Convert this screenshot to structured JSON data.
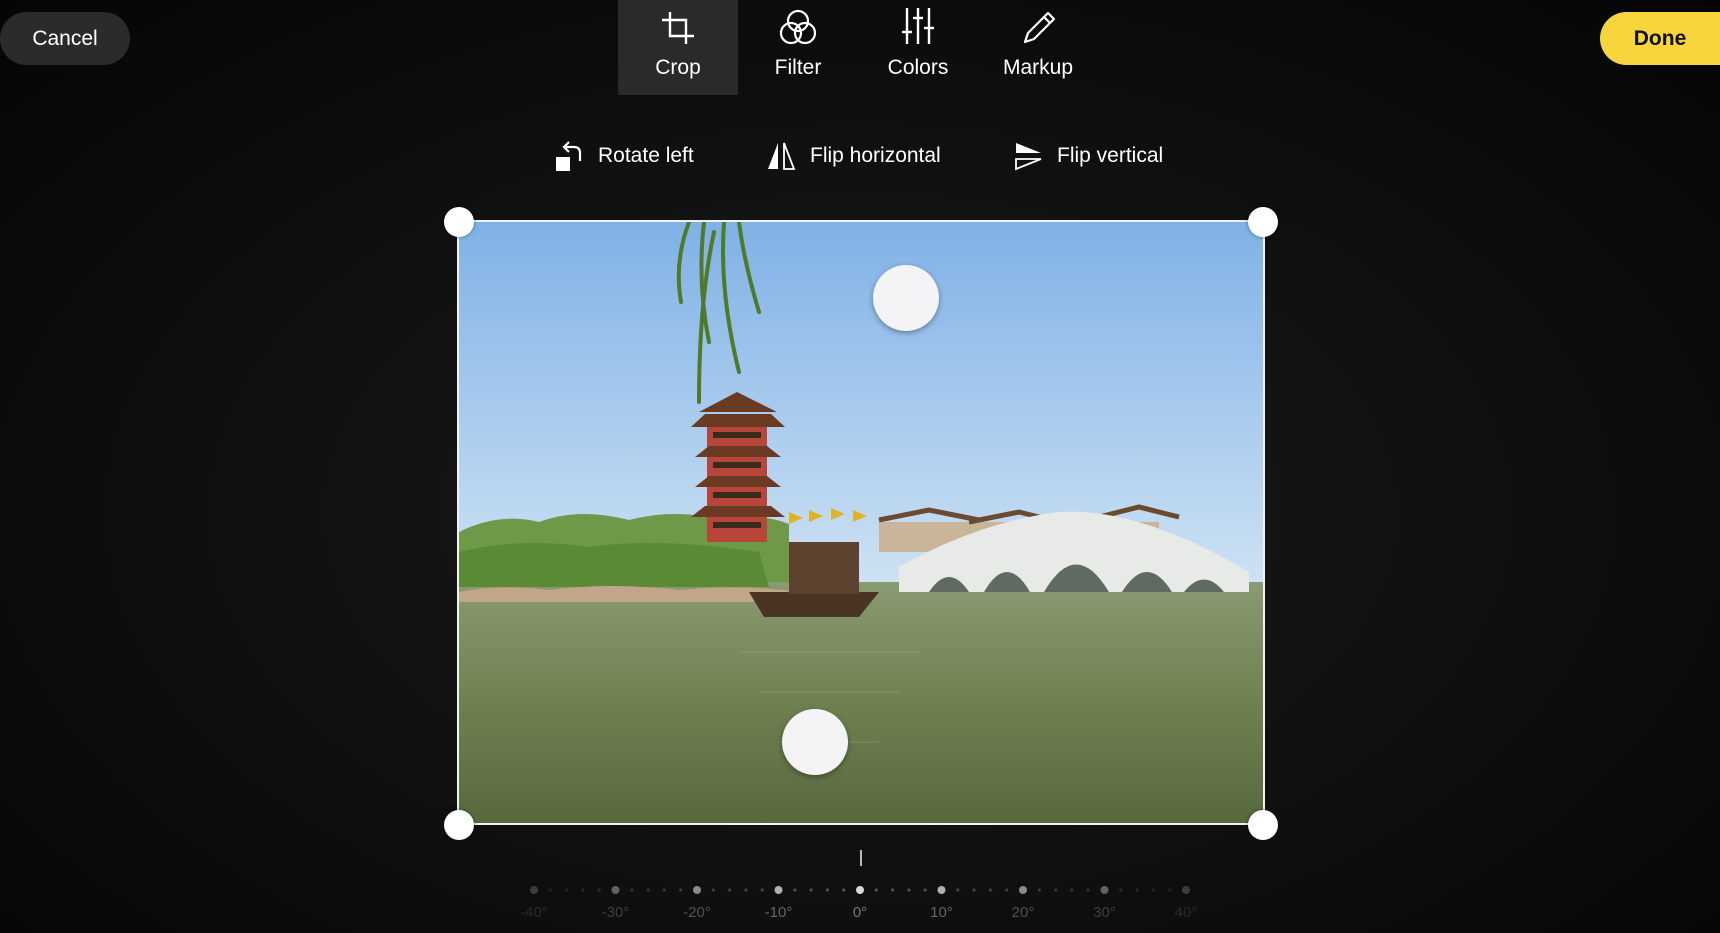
{
  "header": {
    "cancel_label": "Cancel",
    "done_label": "Done",
    "accent_color": "#f8d53c"
  },
  "tabs": [
    {
      "label": "Crop",
      "icon": "crop-icon",
      "active": true
    },
    {
      "label": "Filter",
      "icon": "filter-icon",
      "active": false
    },
    {
      "label": "Colors",
      "icon": "sliders-icon",
      "active": false
    },
    {
      "label": "Markup",
      "icon": "pencil-icon",
      "active": false
    }
  ],
  "tools": {
    "rotate_left": "Rotate left",
    "flip_horizontal": "Flip horizontal",
    "flip_vertical": "Flip vertical"
  },
  "ruler": {
    "labels": [
      "-40°",
      "-30°",
      "-20°",
      "-10°",
      "0°",
      "10°",
      "20°",
      "30°",
      "40°"
    ],
    "current_angle": "0°"
  },
  "image": {
    "subject": "pagoda-lake-bridge-photo"
  }
}
